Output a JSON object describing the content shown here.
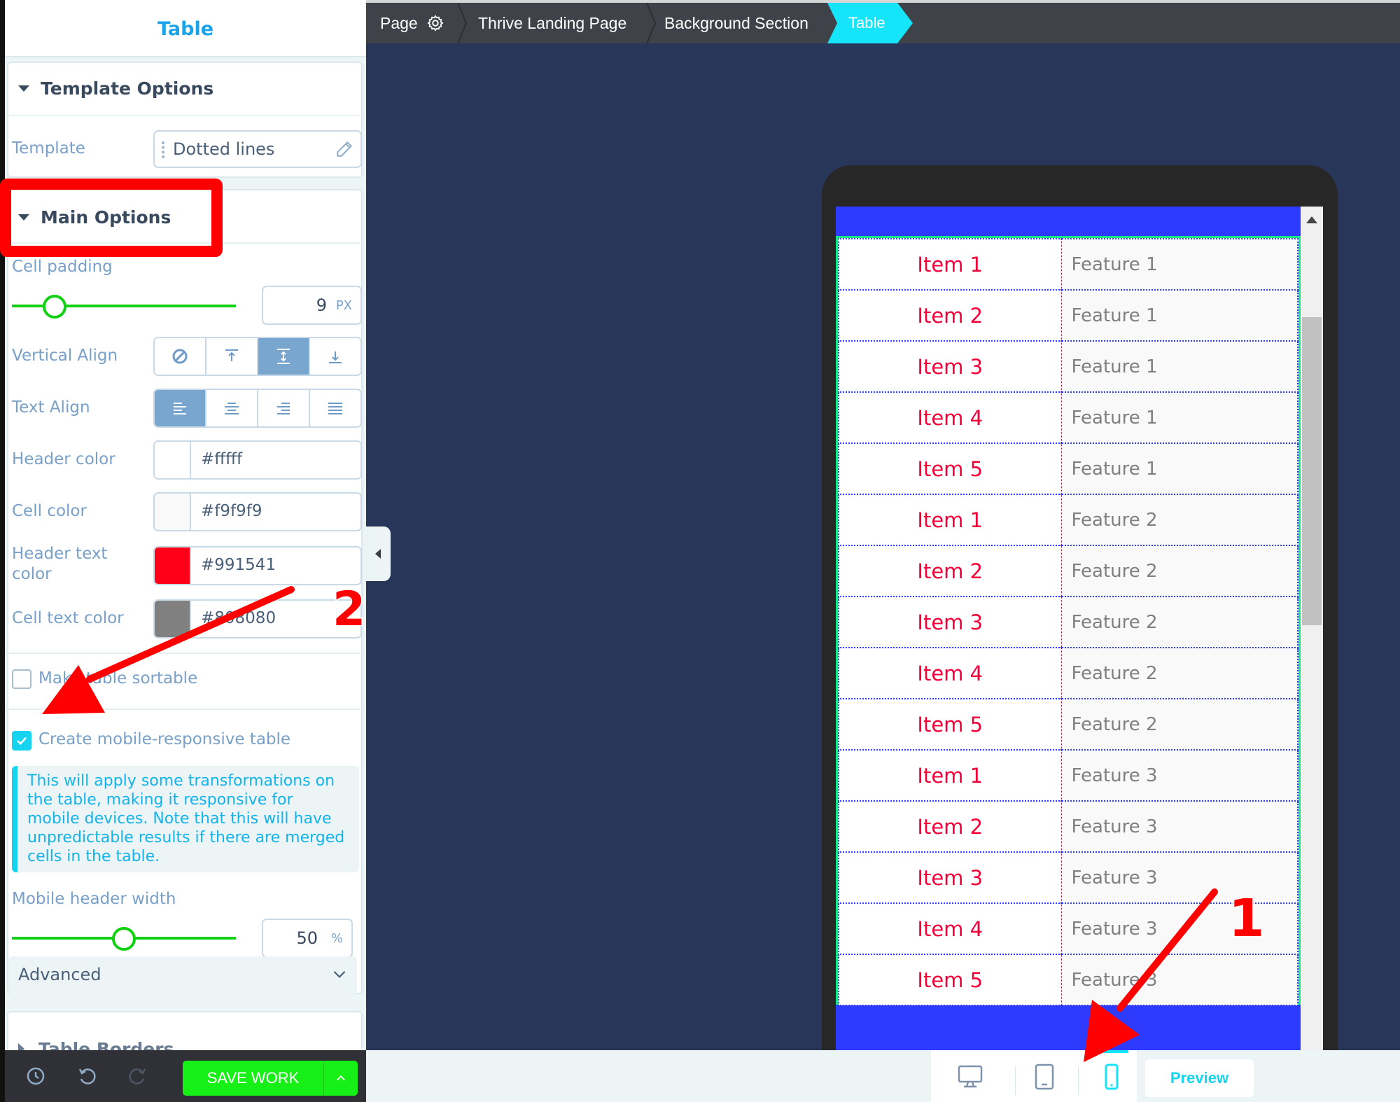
{
  "panel": {
    "title": "Table",
    "template_options": {
      "title": "Template Options",
      "template_label": "Template",
      "template_value": "Dotted lines"
    },
    "main_options": {
      "title": "Main Options",
      "cell_padding": {
        "label": "Cell padding",
        "value": "9",
        "unit": "PX",
        "slider_fraction": 0.19
      },
      "vertical_align": {
        "label": "Vertical Align",
        "options": [
          "none",
          "top",
          "middle",
          "bottom"
        ],
        "selected": "middle"
      },
      "text_align": {
        "label": "Text Align",
        "options": [
          "left",
          "center",
          "right",
          "justify"
        ],
        "selected": "left"
      },
      "header_color": {
        "label": "Header color",
        "value": "#ffffff",
        "display": "#fffff",
        "swatch": "#ffffff"
      },
      "cell_color": {
        "label": "Cell color",
        "value": "#f9f9f9",
        "swatch": "#f9f9f9"
      },
      "header_text_color": {
        "label": "Header text color",
        "label_line1": "Header text",
        "label_line2": "color",
        "value": "#991541",
        "swatch": "#ff0018"
      },
      "cell_text_color": {
        "label": "Cell text color",
        "value": "#808080",
        "swatch": "#808080"
      },
      "sortable": {
        "label": "Make table sortable",
        "checked": false
      },
      "mobile_responsive": {
        "label": "Create mobile-responsive table",
        "checked": true
      },
      "info_text": "This will apply some transformations on the table, making it responsive for mobile devices. Note that this will have unpredictable results if there are merged cells in the table.",
      "mobile_header_width": {
        "label": "Mobile header width",
        "value": "50",
        "unit": "%",
        "slider_fraction": 0.5
      },
      "advanced_label": "Advanced"
    },
    "table_borders": {
      "title": "Table Borders"
    },
    "footer": {
      "save_label": "SAVE WORK"
    }
  },
  "breadcrumb": {
    "items": [
      "Page",
      "Thrive Landing Page",
      "Background Section",
      "Table"
    ],
    "active": "Table"
  },
  "table": {
    "rows": [
      [
        "Item 1",
        "Feature 1"
      ],
      [
        "Item 2",
        "Feature 1"
      ],
      [
        "Item 3",
        "Feature 1"
      ],
      [
        "Item 4",
        "Feature 1"
      ],
      [
        "Item 5",
        "Feature 1"
      ],
      [
        "Item 1",
        "Feature 2"
      ],
      [
        "Item 2",
        "Feature 2"
      ],
      [
        "Item 3",
        "Feature 2"
      ],
      [
        "Item 4",
        "Feature 2"
      ],
      [
        "Item 5",
        "Feature 2"
      ],
      [
        "Item 1",
        "Feature 3"
      ],
      [
        "Item 2",
        "Feature 3"
      ],
      [
        "Item 3",
        "Feature 3"
      ],
      [
        "Item 4",
        "Feature 3"
      ],
      [
        "Item 5",
        "Feature 3"
      ]
    ]
  },
  "devices": {
    "options": [
      "desktop",
      "tablet",
      "mobile"
    ],
    "selected": "mobile",
    "preview_label": "Preview"
  },
  "annotations": {
    "label_1": "1",
    "label_2": "2",
    "color": "#ff0000"
  }
}
